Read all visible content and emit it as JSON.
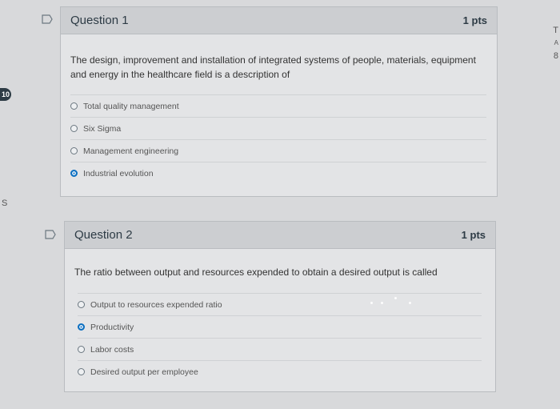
{
  "edge": {
    "badge": "10",
    "left_letter": "S",
    "right_top": "T",
    "right_mid": "A",
    "right_bottom": "8"
  },
  "questions": [
    {
      "title": "Question 1",
      "points": "1 pts",
      "text": "The design, improvement and installation of integrated systems of people, materials, equipment and energy in the healthcare field is a description of",
      "answers": [
        {
          "label": "Total quality management",
          "checked": false
        },
        {
          "label": "Six Sigma",
          "checked": false
        },
        {
          "label": "Management engineering",
          "checked": false
        },
        {
          "label": "Industrial evolution",
          "checked": true
        }
      ]
    },
    {
      "title": "Question 2",
      "points": "1 pts",
      "text": "The ratio between output and resources expended to obtain a desired output is called",
      "answers": [
        {
          "label": "Output to resources expended ratio",
          "checked": false
        },
        {
          "label": "Productivity",
          "checked": true
        },
        {
          "label": "Labor costs",
          "checked": false
        },
        {
          "label": "Desired output per employee",
          "checked": false
        }
      ]
    }
  ],
  "icons": {
    "flag": "flag-icon",
    "radio": "radio-button"
  },
  "colors": {
    "accent": "#0b6fc1",
    "header": "#ccced1",
    "panel": "#e3e4e6"
  }
}
